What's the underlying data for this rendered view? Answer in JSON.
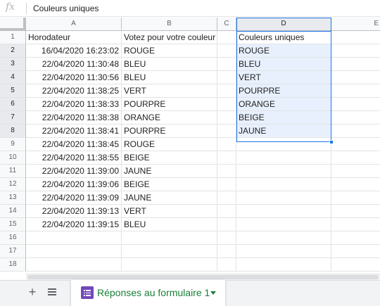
{
  "formula_bar": {
    "fx": "fx",
    "content": "Couleurs uniques"
  },
  "columns": [
    "A",
    "B",
    "C",
    "D",
    "E"
  ],
  "header_row": {
    "a": "Horodateur",
    "b": "Votez pour votre couleur préférée",
    "c": "",
    "d": "Couleurs uniques"
  },
  "rows": [
    {
      "n": "1"
    },
    {
      "n": "2",
      "a": "16/04/2020 16:23:02",
      "b": "ROUGE",
      "d": "ROUGE"
    },
    {
      "n": "3",
      "a": "22/04/2020 11:30:48",
      "b": "BLEU",
      "d": "BLEU"
    },
    {
      "n": "4",
      "a": "22/04/2020 11:30:56",
      "b": "BLEU",
      "d": "VERT"
    },
    {
      "n": "5",
      "a": "22/04/2020 11:38:25",
      "b": "VERT",
      "d": "POURPRE"
    },
    {
      "n": "6",
      "a": "22/04/2020 11:38:33",
      "b": "POURPRE",
      "d": "ORANGE"
    },
    {
      "n": "7",
      "a": "22/04/2020 11:38:38",
      "b": "ORANGE",
      "d": "BEIGE"
    },
    {
      "n": "8",
      "a": "22/04/2020 11:38:41",
      "b": "POURPRE",
      "d": "JAUNE"
    },
    {
      "n": "9",
      "a": "22/04/2020 11:38:45",
      "b": "ROUGE",
      "d": ""
    },
    {
      "n": "10",
      "a": "22/04/2020 11:38:55",
      "b": "BEIGE",
      "d": ""
    },
    {
      "n": "11",
      "a": "22/04/2020 11:39:00",
      "b": "JAUNE",
      "d": ""
    },
    {
      "n": "12",
      "a": "22/04/2020 11:39:06",
      "b": "BEIGE",
      "d": ""
    },
    {
      "n": "13",
      "a": "22/04/2020 11:39:09",
      "b": "JAUNE",
      "d": ""
    },
    {
      "n": "14",
      "a": "22/04/2020 11:39:13",
      "b": "VERT",
      "d": ""
    },
    {
      "n": "15",
      "a": "22/04/2020 11:39:15",
      "b": "BLEU",
      "d": ""
    },
    {
      "n": "16"
    },
    {
      "n": "17"
    },
    {
      "n": "18"
    }
  ],
  "sheet_bar": {
    "add_icon": "plus-icon",
    "list_icon": "sheet-list-icon",
    "active_tab": "Réponses au formulaire 1"
  },
  "colors": {
    "selection": "#1a73e8",
    "selection_fill": "#e8f0fe",
    "tab_text": "#188038",
    "forms_icon": "#7248b9"
  }
}
